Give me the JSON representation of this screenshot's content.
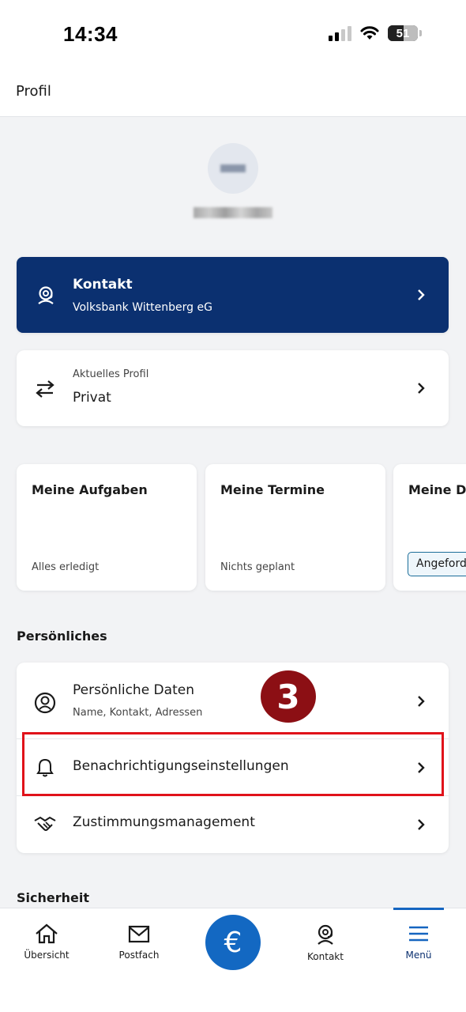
{
  "status_bar": {
    "time": "14:34",
    "battery": "51"
  },
  "header": {
    "title": "Profil"
  },
  "contact": {
    "title": "Kontakt",
    "bank": "Volksbank Wittenberg eG"
  },
  "profile": {
    "label": "Aktuelles Profil",
    "value": "Privat"
  },
  "tiles": [
    {
      "title": "Meine Aufgaben",
      "status": "Alles erledigt"
    },
    {
      "title": "Meine Termine",
      "status": "Nichts geplant"
    },
    {
      "title": "Meine Do",
      "badge": "Angeford"
    }
  ],
  "personal": {
    "section_title": "Persönliches",
    "items": [
      {
        "title": "Persönliche Daten",
        "subtitle": "Name, Kontakt, Adressen"
      },
      {
        "title": "Benachrichtigungseinstellungen"
      },
      {
        "title": "Zustimmungsmanagement"
      }
    ]
  },
  "security": {
    "section_title": "Sicherheit"
  },
  "annotation": {
    "step": "3",
    "highlight_color": "#e0121a",
    "badge_color": "#8c0f14"
  },
  "nav": {
    "items": [
      {
        "label": "Übersicht",
        "icon": "home-icon"
      },
      {
        "label": "Postfach",
        "icon": "mail-icon"
      },
      {
        "label": "€",
        "icon": "euro-icon"
      },
      {
        "label": "Kontakt",
        "icon": "headset-icon"
      },
      {
        "label": "Menü",
        "icon": "menu-icon"
      }
    ],
    "active": "Menü"
  },
  "colors": {
    "brand_dark": "#0b3070",
    "accent": "#1368c2",
    "background": "#f2f3f5"
  }
}
